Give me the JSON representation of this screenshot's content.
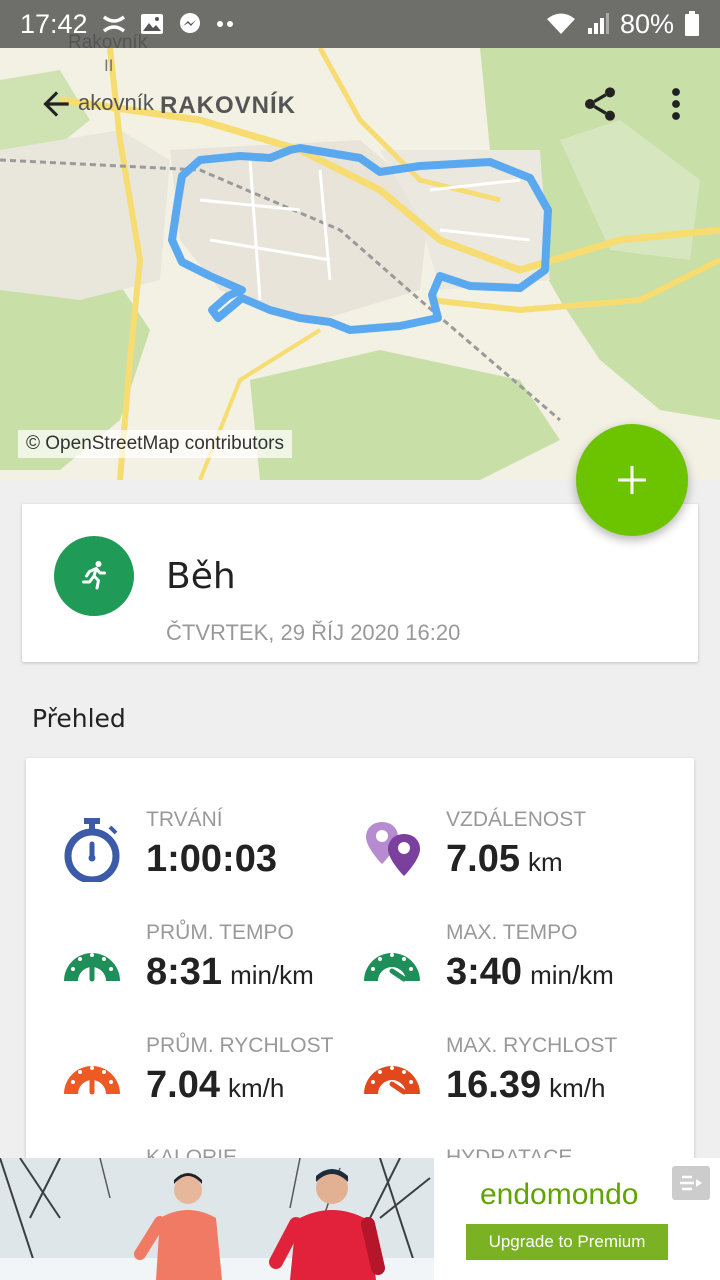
{
  "status_bar": {
    "time": "17:42",
    "battery": "80%",
    "notification_icons": [
      "under-armour-icon",
      "gallery-icon",
      "messenger-icon",
      "more-dots-icon"
    ]
  },
  "map": {
    "labels": {
      "town_upper": "Rakovník",
      "town_left": "akovník",
      "town_main": "RAKOVNÍK",
      "road_number": "II"
    },
    "attribution": "© OpenStreetMap contributors",
    "route_color": "#5aa9f0"
  },
  "activity": {
    "title": "Běh",
    "date": "ČTVRTEK, 29 ŘÍJ 2020 16:20",
    "sport_icon": "running-person-icon",
    "sport_color": "#1f9a57"
  },
  "overview": {
    "section_title": "Přehled",
    "stats": {
      "duration": {
        "label": "TRVÁNÍ",
        "value": "1:00:03",
        "unit": ""
      },
      "distance": {
        "label": "VZDÁLENOST",
        "value": "7.05",
        "unit": "km"
      },
      "avg_pace": {
        "label": "PRŮM. TEMPO",
        "value": "8:31",
        "unit": "min/km"
      },
      "max_pace": {
        "label": "MAX. TEMPO",
        "value": "3:40",
        "unit": "min/km"
      },
      "avg_speed": {
        "label": "PRŮM. RYCHLOST",
        "value": "7.04",
        "unit": "km/h"
      },
      "max_speed": {
        "label": "MAX. RYCHLOST",
        "value": "16.39",
        "unit": "km/h"
      },
      "calories": {
        "label": "KALORIE"
      },
      "hydration": {
        "label": "HYDRATACE"
      }
    }
  },
  "ad": {
    "brand": "endomondo",
    "cta": "Upgrade to Premium"
  },
  "colors": {
    "fab": "#6cc300",
    "pace_green": "#1f8f5a",
    "speed_orange": "#ee5a24",
    "timer_blue": "#3b5aa8",
    "distance_purple": "#7b3f9e"
  }
}
